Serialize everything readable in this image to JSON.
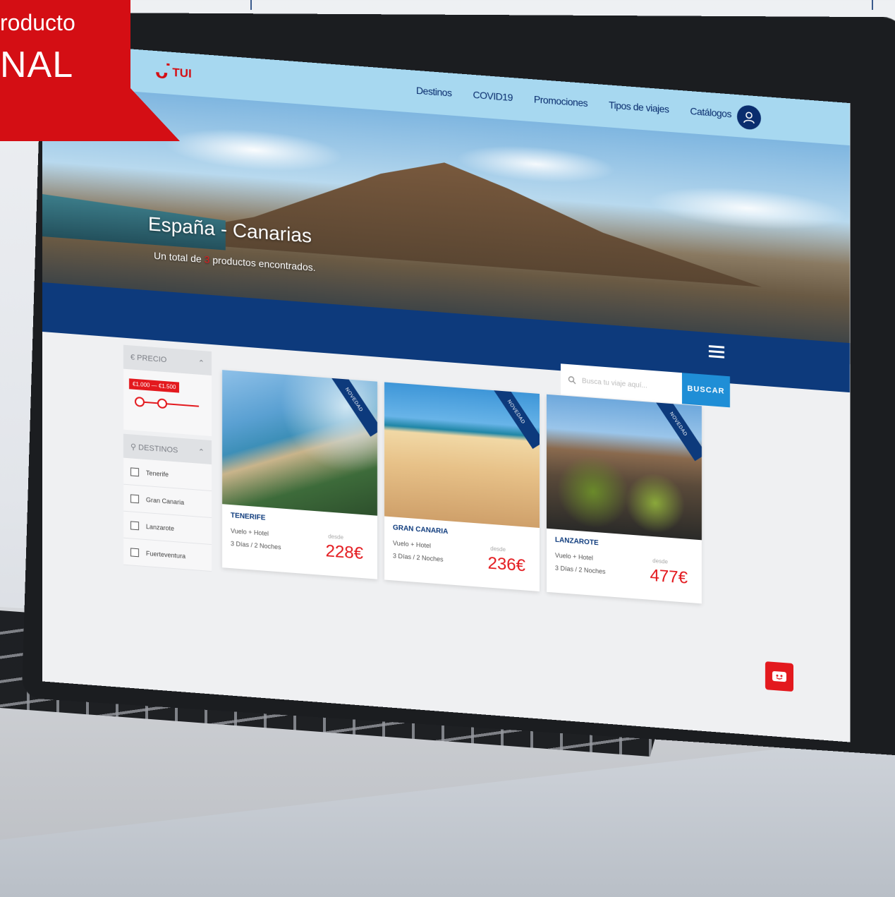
{
  "banner": {
    "line1": "roducto",
    "line2": "NAL"
  },
  "site": {
    "logo_text": "TUI",
    "nav": [
      "Destinos",
      "COVID19",
      "Promociones",
      "Tipos de viajes",
      "Catálogos"
    ]
  },
  "hero": {
    "title": "España - Canarias",
    "subtitle_prefix": "Un total de",
    "subtitle_count": "3",
    "subtitle_suffix": "productos encontrados."
  },
  "search": {
    "placeholder": "Busca tu viaje aquí...",
    "button": "BUSCAR"
  },
  "filters": {
    "price": {
      "label": "€ PRECIO",
      "range": "€1.000 — €1.500"
    },
    "destinations": {
      "label": "DESTINOS",
      "items": [
        "Tenerife",
        "Gran Canaria",
        "Lanzarote",
        "Fuerteventura"
      ]
    }
  },
  "cards": [
    {
      "name": "TENERIFE",
      "type": "Vuelo + Hotel",
      "duration": "3 Días / 2 Noches",
      "from": "desde",
      "price": "228€",
      "ribbon": "NOVEDAD"
    },
    {
      "name": "GRAN CANARIA",
      "type": "Vuelo + Hotel",
      "duration": "3 Días / 2 Noches",
      "from": "desde",
      "price": "236€",
      "ribbon": "NOVEDAD"
    },
    {
      "name": "LANZAROTE",
      "type": "Vuelo + Hotel",
      "duration": "3 Días / 2 Noches",
      "from": "desde",
      "price": "477€",
      "ribbon": "NOVEDAD"
    }
  ],
  "icons": {
    "user": "user-icon",
    "menu": "hamburger-menu-icon",
    "search": "search-icon",
    "chat": "chat-bot-icon",
    "chevron": "chevron-up-icon",
    "pin": "location-pin-icon"
  },
  "colors": {
    "brand_red": "#e3191e",
    "brand_navy": "#0d3a7c",
    "nav_sky": "#a7d8f0",
    "accent_blue": "#1f8ed6"
  }
}
